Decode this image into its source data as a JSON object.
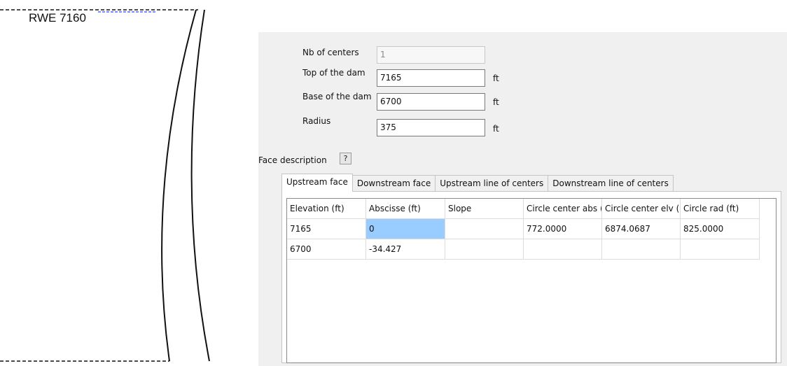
{
  "sketch": {
    "label": "RWE 7160"
  },
  "form": {
    "nb_centers": {
      "label": "Nb of centers",
      "value": "1"
    },
    "top_dam": {
      "label": "Top of the dam",
      "value": "7165",
      "unit": "ft"
    },
    "base_dam": {
      "label": "Base of the dam",
      "value": "6700",
      "unit": "ft"
    },
    "radius": {
      "label": "Radius",
      "value": "375",
      "unit": "ft"
    }
  },
  "face_description": {
    "label": "Face description",
    "help_label": "?"
  },
  "tabs": [
    {
      "label": "Upstream face",
      "active": true
    },
    {
      "label": "Downstream face",
      "active": false
    },
    {
      "label": "Upstream line of centers",
      "active": false
    },
    {
      "label": "Downstream line of centers",
      "active": false
    }
  ],
  "grid": {
    "headers": [
      "Elevation (ft)",
      "Abscisse (ft)",
      "Slope",
      "Circle center abs (",
      "Circle center elv (",
      "Circle rad (ft)"
    ],
    "rows": [
      [
        "7165",
        "0",
        "",
        "772.0000",
        "6874.0687",
        "825.0000"
      ],
      [
        "6700",
        "-34.427",
        "",
        "",
        "",
        ""
      ]
    ],
    "selected_cell": {
      "row": 0,
      "col": 1
    },
    "selected_color": "#99ccff"
  }
}
